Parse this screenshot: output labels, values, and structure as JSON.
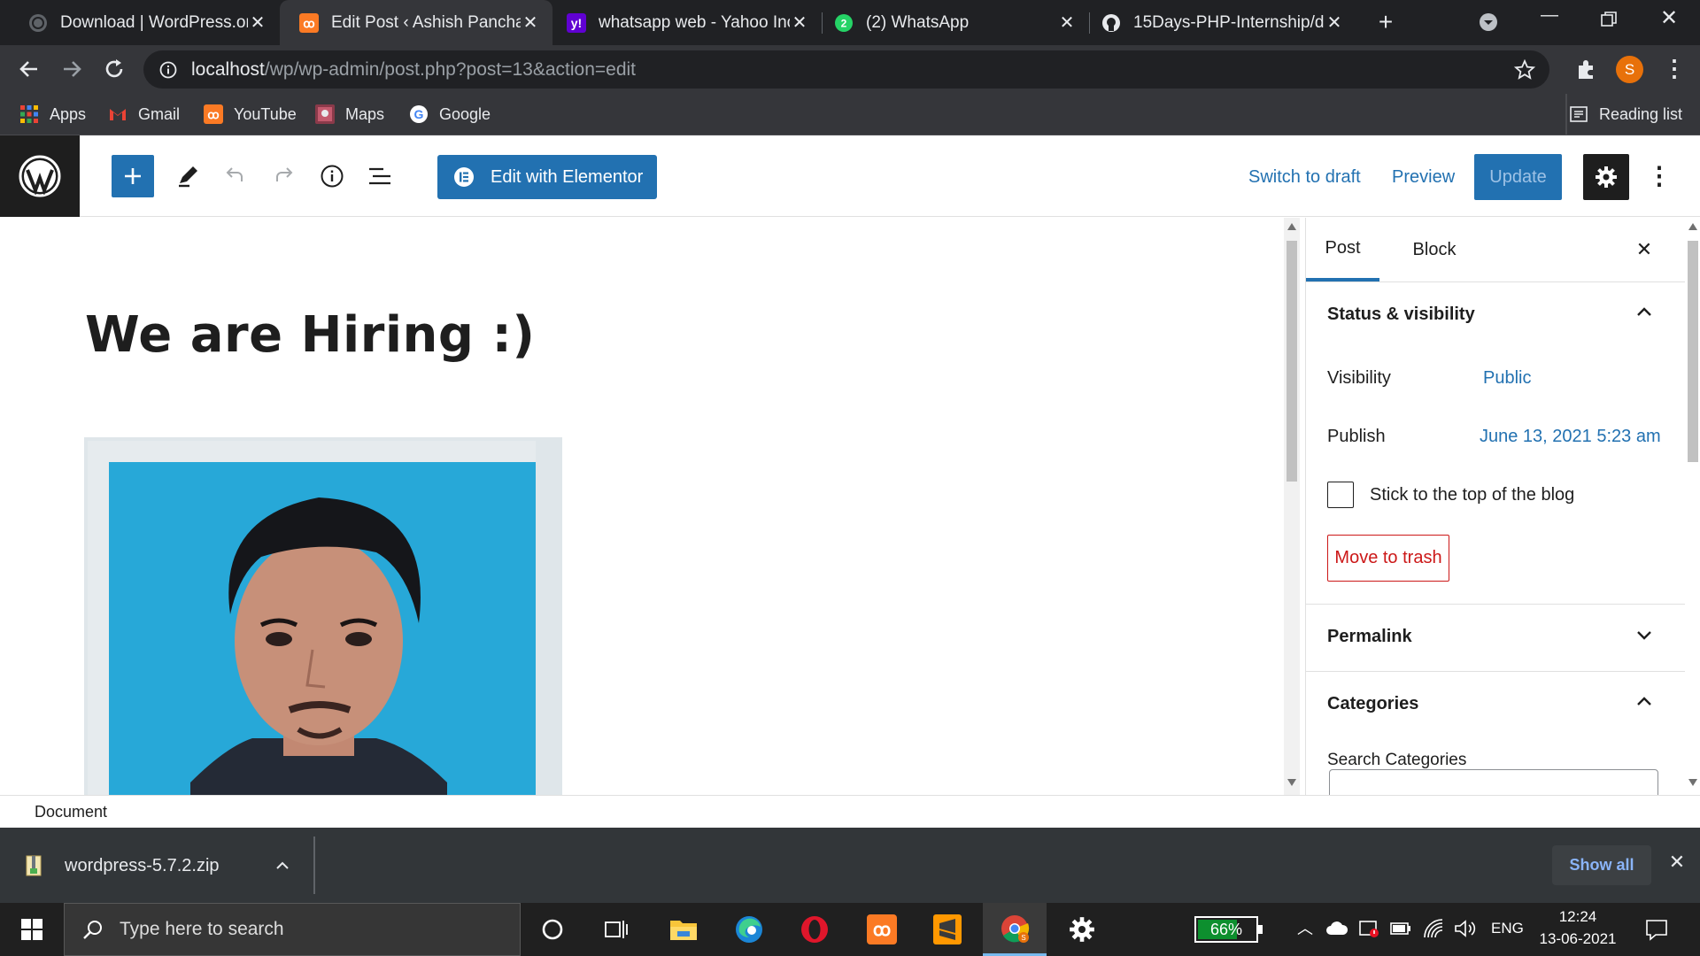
{
  "browser": {
    "tabs": [
      {
        "label": "Download | WordPress.org",
        "icon": "wordpress-globe-icon"
      },
      {
        "label": "Edit Post ‹ Ashish Panchal",
        "icon": "xampp-icon",
        "active": true
      },
      {
        "label": "whatsapp web - Yahoo Inc",
        "icon": "yahoo-icon"
      },
      {
        "label": "(2) WhatsApp",
        "icon": "whatsapp-icon"
      },
      {
        "label": "15Days-PHP-Internship/d",
        "icon": "github-icon"
      }
    ],
    "url_host": "localhost",
    "url_path": "/wp/wp-admin/post.php?post=13&action=edit",
    "profile_initial": "S",
    "bookmarks": [
      "Apps",
      "Gmail",
      "YouTube",
      "Maps",
      "Google"
    ],
    "reading_list": "Reading list"
  },
  "editor": {
    "elementor_label": "Edit with Elementor",
    "switch_to_draft": "Switch to draft",
    "preview": "Preview",
    "update": "Update",
    "post_title": "We are Hiring :)",
    "breadcrumb": "Document"
  },
  "sidebar": {
    "tab_post": "Post",
    "tab_block": "Block",
    "status_title": "Status & visibility",
    "visibility_label": "Visibility",
    "visibility_value": "Public",
    "publish_label": "Publish",
    "publish_value": "June 13, 2021 5:23 am",
    "sticky_label": "Stick to the top of the blog",
    "sticky_checked": false,
    "trash_label": "Move to trash",
    "permalink_title": "Permalink",
    "categories_title": "Categories",
    "search_categories_label": "Search Categories"
  },
  "download": {
    "filename": "wordpress-5.7.2.zip",
    "show_all": "Show all"
  },
  "taskbar": {
    "search_placeholder": "Type here to search",
    "battery": "66%",
    "language": "ENG",
    "time": "12:24",
    "date": "13-06-2021"
  },
  "colors": {
    "wp_blue": "#2271b1",
    "trash_red": "#cc1818",
    "chrome_dark": "#202124",
    "chrome_mid": "#35363a"
  }
}
